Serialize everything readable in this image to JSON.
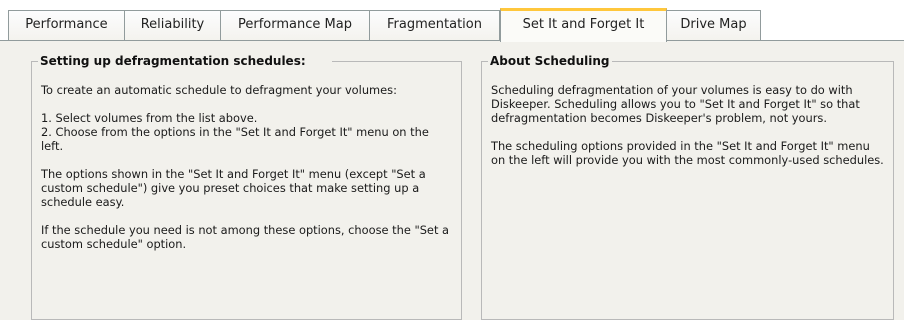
{
  "tabs": [
    {
      "label": "Performance",
      "active": false
    },
    {
      "label": "Reliability",
      "active": false
    },
    {
      "label": "Performance Map",
      "active": false
    },
    {
      "label": "Fragmentation",
      "active": false
    },
    {
      "label": "Set It and Forget It",
      "active": true
    },
    {
      "label": "Drive Map",
      "active": false
    }
  ],
  "left_panel": {
    "title": "Setting up defragmentation schedules:",
    "intro": "To create an automatic schedule to defragment your volumes:",
    "steps": [
      "1.  Select volumes from the list above.",
      "2.  Choose from the options in the \"Set It and Forget It\" menu on the left."
    ],
    "options_text": "The options shown in the \"Set It and Forget It\" menu (except \"Set a custom schedule\") give you preset choices that make setting up a schedule easy.",
    "custom_text": "If the schedule you need is not among these options, choose the \"Set a custom schedule\" option."
  },
  "right_panel": {
    "title": "About Scheduling",
    "para1": "Scheduling defragmentation of your volumes is easy to do with Diskeeper.  Scheduling allows you to \"Set It and Forget It\" so that defragmentation becomes Diskeeper's problem, not yours.",
    "para2": "The scheduling options provided in the \"Set It and Forget It\" menu on the left will provide you with the most commonly-used schedules."
  },
  "colors": {
    "active_tab_accent": "#ffc73c",
    "panel_background": "#f2f1ec",
    "tab_border": "#919b9c"
  }
}
